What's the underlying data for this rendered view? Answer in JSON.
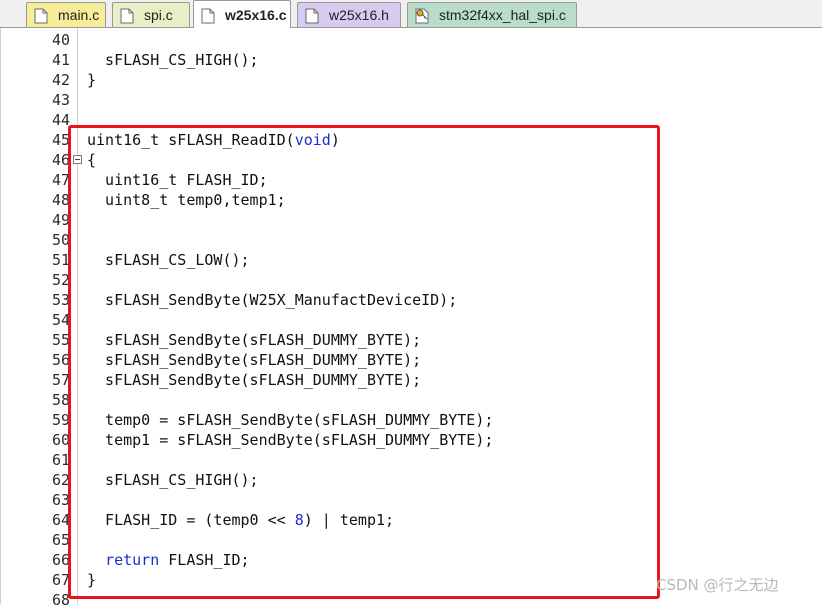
{
  "tabs": [
    {
      "label": "main.c",
      "color": "#f7ec98",
      "active": false
    },
    {
      "label": "spi.c",
      "color": "#e8efc4",
      "active": false
    },
    {
      "label": "w25x16.c",
      "color": "#f4c9c9",
      "active": true
    },
    {
      "label": "w25x16.h",
      "color": "#d8cbf0",
      "active": false
    },
    {
      "label": "stm32f4xx_hal_spi.c",
      "color": "#b9ddc9",
      "active": false
    }
  ],
  "line_numbers": [
    "40",
    "41",
    "42",
    "43",
    "44",
    "45",
    "46",
    "47",
    "48",
    "49",
    "50",
    "51",
    "52",
    "53",
    "54",
    "55",
    "56",
    "57",
    "58",
    "59",
    "60",
    "61",
    "62",
    "63",
    "64",
    "65",
    "66",
    "67",
    "68"
  ],
  "code_lines": [
    {
      "n": "40",
      "text": ""
    },
    {
      "n": "41",
      "text": "  sFLASH_CS_HIGH();"
    },
    {
      "n": "42",
      "text": "}"
    },
    {
      "n": "43",
      "text": ""
    },
    {
      "n": "44",
      "text": ""
    },
    {
      "n": "45",
      "text": "uint16_t sFLASH_ReadID(void)"
    },
    {
      "n": "46",
      "text": "{"
    },
    {
      "n": "47",
      "text": "  uint16_t FLASH_ID;"
    },
    {
      "n": "48",
      "text": "  uint8_t temp0,temp1;"
    },
    {
      "n": "49",
      "text": ""
    },
    {
      "n": "50",
      "text": ""
    },
    {
      "n": "51",
      "text": "  sFLASH_CS_LOW();"
    },
    {
      "n": "52",
      "text": ""
    },
    {
      "n": "53",
      "text": "  sFLASH_SendByte(W25X_ManufactDeviceID);"
    },
    {
      "n": "54",
      "text": ""
    },
    {
      "n": "55",
      "text": "  sFLASH_SendByte(sFLASH_DUMMY_BYTE);"
    },
    {
      "n": "56",
      "text": "  sFLASH_SendByte(sFLASH_DUMMY_BYTE);"
    },
    {
      "n": "57",
      "text": "  sFLASH_SendByte(sFLASH_DUMMY_BYTE);"
    },
    {
      "n": "58",
      "text": ""
    },
    {
      "n": "59",
      "text": "  temp0 = sFLASH_SendByte(sFLASH_DUMMY_BYTE);"
    },
    {
      "n": "60",
      "text": "  temp1 = sFLASH_SendByte(sFLASH_DUMMY_BYTE);"
    },
    {
      "n": "61",
      "text": ""
    },
    {
      "n": "62",
      "text": "  sFLASH_CS_HIGH();"
    },
    {
      "n": "63",
      "text": ""
    },
    {
      "n": "64",
      "text": "  FLASH_ID = (temp0 << 8) | temp1;"
    },
    {
      "n": "65",
      "text": ""
    },
    {
      "n": "66",
      "text": "  return FLASH_ID;"
    },
    {
      "n": "67",
      "text": "}"
    },
    {
      "n": "68",
      "text": ""
    }
  ],
  "keywords": [
    "void",
    "return",
    "8"
  ],
  "keyword_color": "#1a2fd0",
  "highlight_color": "#e8141a",
  "watermark": "CSDN @行之无边"
}
